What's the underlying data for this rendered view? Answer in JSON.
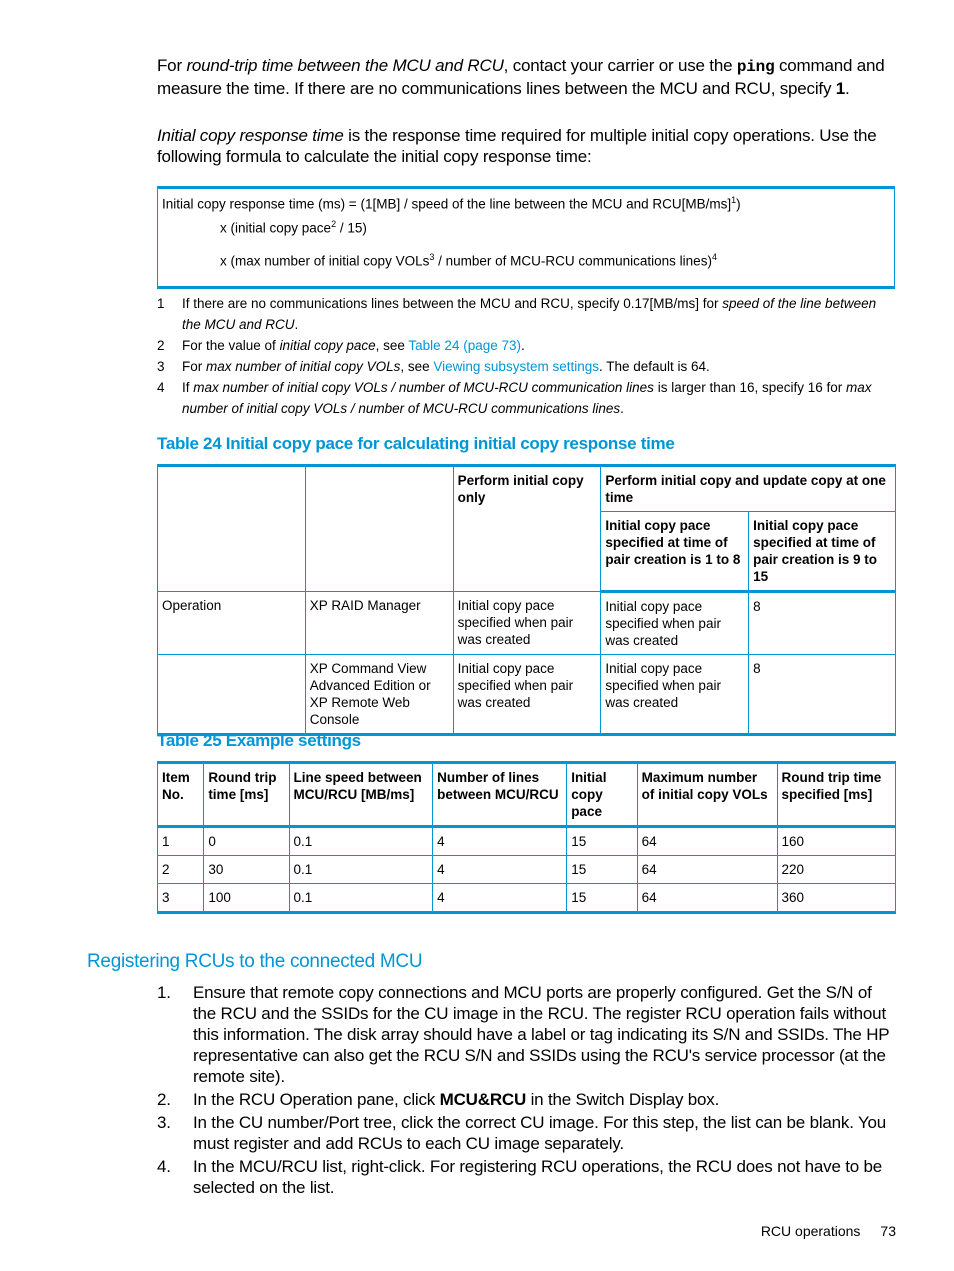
{
  "intro": {
    "p1_prefix": "For ",
    "p1_italic": "round-trip time between the MCU and RCU",
    "p1_mid": ", contact your carrier or use the ",
    "p1_code": "ping",
    "p1_suffix": " command and measure the time. If there are no communications lines between the MCU and RCU, specify ",
    "p1_bold": "1",
    "p1_end": ".",
    "p2_italic": "Initial copy response time",
    "p2_rest": " is the response time required for multiple initial copy operations. Use the following formula to calculate the initial copy response time:"
  },
  "formula": {
    "line1": "Initial copy response time (ms) = (1[MB] / speed of the line between the MCU and RCU[MB/ms]",
    "line1_sup": "1",
    "line1_end": ")",
    "line2": "x (initial copy pace",
    "line2_sup": "2",
    "line2_end": " / 15)",
    "line3": "x (max number of initial copy VOLs",
    "line3_sup": "3",
    "line3_mid": " / number of MCU-RCU communications lines)",
    "line3_sup2": "4"
  },
  "notes": [
    {
      "n": "1",
      "a": "If there are no communications lines between the MCU and RCU, specify 0.17[MB/ms] for ",
      "i": "speed of the line between the MCU and RCU",
      "b": "."
    },
    {
      "n": "2",
      "a": "For the value of ",
      "i": "initial copy pace",
      "b": ", see ",
      "link": "Table 24 (page 73)",
      "c": "."
    },
    {
      "n": "3",
      "a": "For ",
      "i": "max number of initial copy VOLs",
      "b": ", see ",
      "link": "Viewing subsystem settings",
      "c": ". The default is 64."
    },
    {
      "n": "4",
      "a": "If ",
      "i": "max number of initial copy VOLs / number of MCU-RCU communication lines",
      "b": " is larger than 16, specify 16 for ",
      "i2": "max number of initial copy VOLs / number of MCU-RCU communications lines",
      "c": "."
    }
  ],
  "table24": {
    "caption": "Table 24 Initial copy pace for calculating initial copy response time",
    "header": {
      "col3": "Perform initial copy only",
      "col45": "Perform initial copy and update copy at one time",
      "col4": "Initial copy pace specified at time of pair creation is 1 to 8",
      "col5": "Initial copy pace specified at time of pair creation is 9 to 15"
    },
    "rows": [
      [
        "Operation",
        "XP RAID Manager",
        "Initial copy pace specified when pair was created",
        "Initial copy pace specified when pair was created",
        "8"
      ],
      [
        "",
        "XP Command View Advanced Edition or XP Remote Web Console",
        "Initial copy pace specified when pair was created",
        "Initial copy pace specified when pair was created",
        "8"
      ]
    ]
  },
  "table25": {
    "caption": "Table 25 Example settings",
    "headers": [
      "Item No.",
      "Round trip time [ms]",
      "Line speed between MCU/RCU [MB/ms]",
      "Number of lines between MCU/RCU",
      "Initial copy pace",
      "Maximum number of initial copy VOLs",
      "Round trip time specified [ms]"
    ],
    "rows": [
      [
        "1",
        "0",
        "0.1",
        "4",
        "15",
        "64",
        "160"
      ],
      [
        "2",
        "30",
        "0.1",
        "4",
        "15",
        "64",
        "220"
      ],
      [
        "3",
        "100",
        "0.1",
        "4",
        "15",
        "64",
        "360"
      ]
    ]
  },
  "section": {
    "heading": "Registering RCUs to the connected MCU",
    "steps": [
      {
        "n": "1.",
        "text": "Ensure that remote copy connections and MCU ports are properly configured. Get the S/N of the RCU and the SSIDs for the CU image in the RCU. The register RCU operation fails without this information. The disk array should have a label or tag indicating its S/N and SSIDs. The HP representative can also get the RCU S/N and SSIDs using the RCU's service processor (at the remote site)."
      },
      {
        "n": "2.",
        "pre": "In the RCU Operation pane, click ",
        "bold": "MCU&RCU",
        "post": " in the Switch Display box."
      },
      {
        "n": "3.",
        "text": "In the CU number/Port tree, click the correct CU image. For this step, the list can be blank. You must register and add RCUs to each CU image separately."
      },
      {
        "n": "4.",
        "text": "In the MCU/RCU list, right-click. For registering RCU operations, the RCU does not have to be selected on the list."
      }
    ]
  },
  "footer": {
    "section": "RCU operations",
    "page": "73"
  }
}
